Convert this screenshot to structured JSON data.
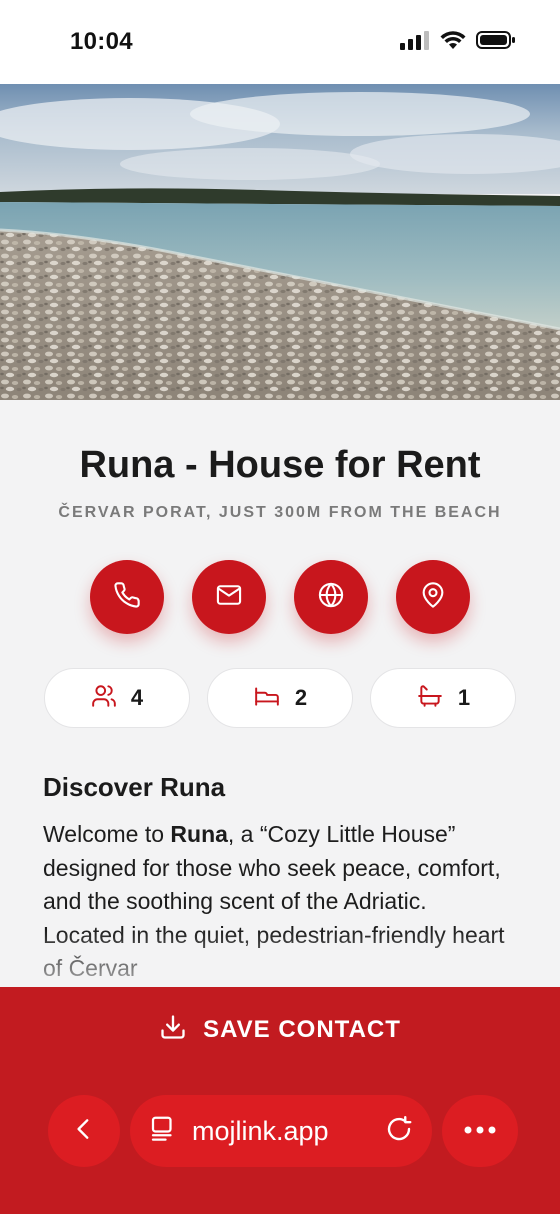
{
  "status_bar": {
    "time": "10:04"
  },
  "hero": {
    "image_alt": "Pebble beach by the Adriatic sea"
  },
  "listing": {
    "title": "Runa - House for Rent",
    "subtitle": "ČERVAR PORAT, JUST 300M FROM THE BEACH"
  },
  "actions": [
    {
      "icon": "phone-icon"
    },
    {
      "icon": "mail-icon"
    },
    {
      "icon": "globe-icon"
    },
    {
      "icon": "location-pin-icon"
    }
  ],
  "stats": [
    {
      "icon": "guests-icon",
      "value": "4"
    },
    {
      "icon": "bed-icon",
      "value": "2"
    },
    {
      "icon": "bathtub-icon",
      "value": "1"
    }
  ],
  "about": {
    "heading": "Discover Runa",
    "text_before": "Welcome to ",
    "text_bold": "Runa",
    "text_after": ", a “Cozy Little House” designed for those who seek peace, comfort, and the soothing scent of the Adriatic. Located in the quiet, pedestrian-friendly heart of Červar"
  },
  "bottom": {
    "save_label": "SAVE CONTACT",
    "url": "mojlink.app"
  },
  "colors": {
    "accent": "#c8161d",
    "bottom_bar": "#c21b20",
    "pill": "#dc1d22",
    "background": "#f3f3f4"
  }
}
